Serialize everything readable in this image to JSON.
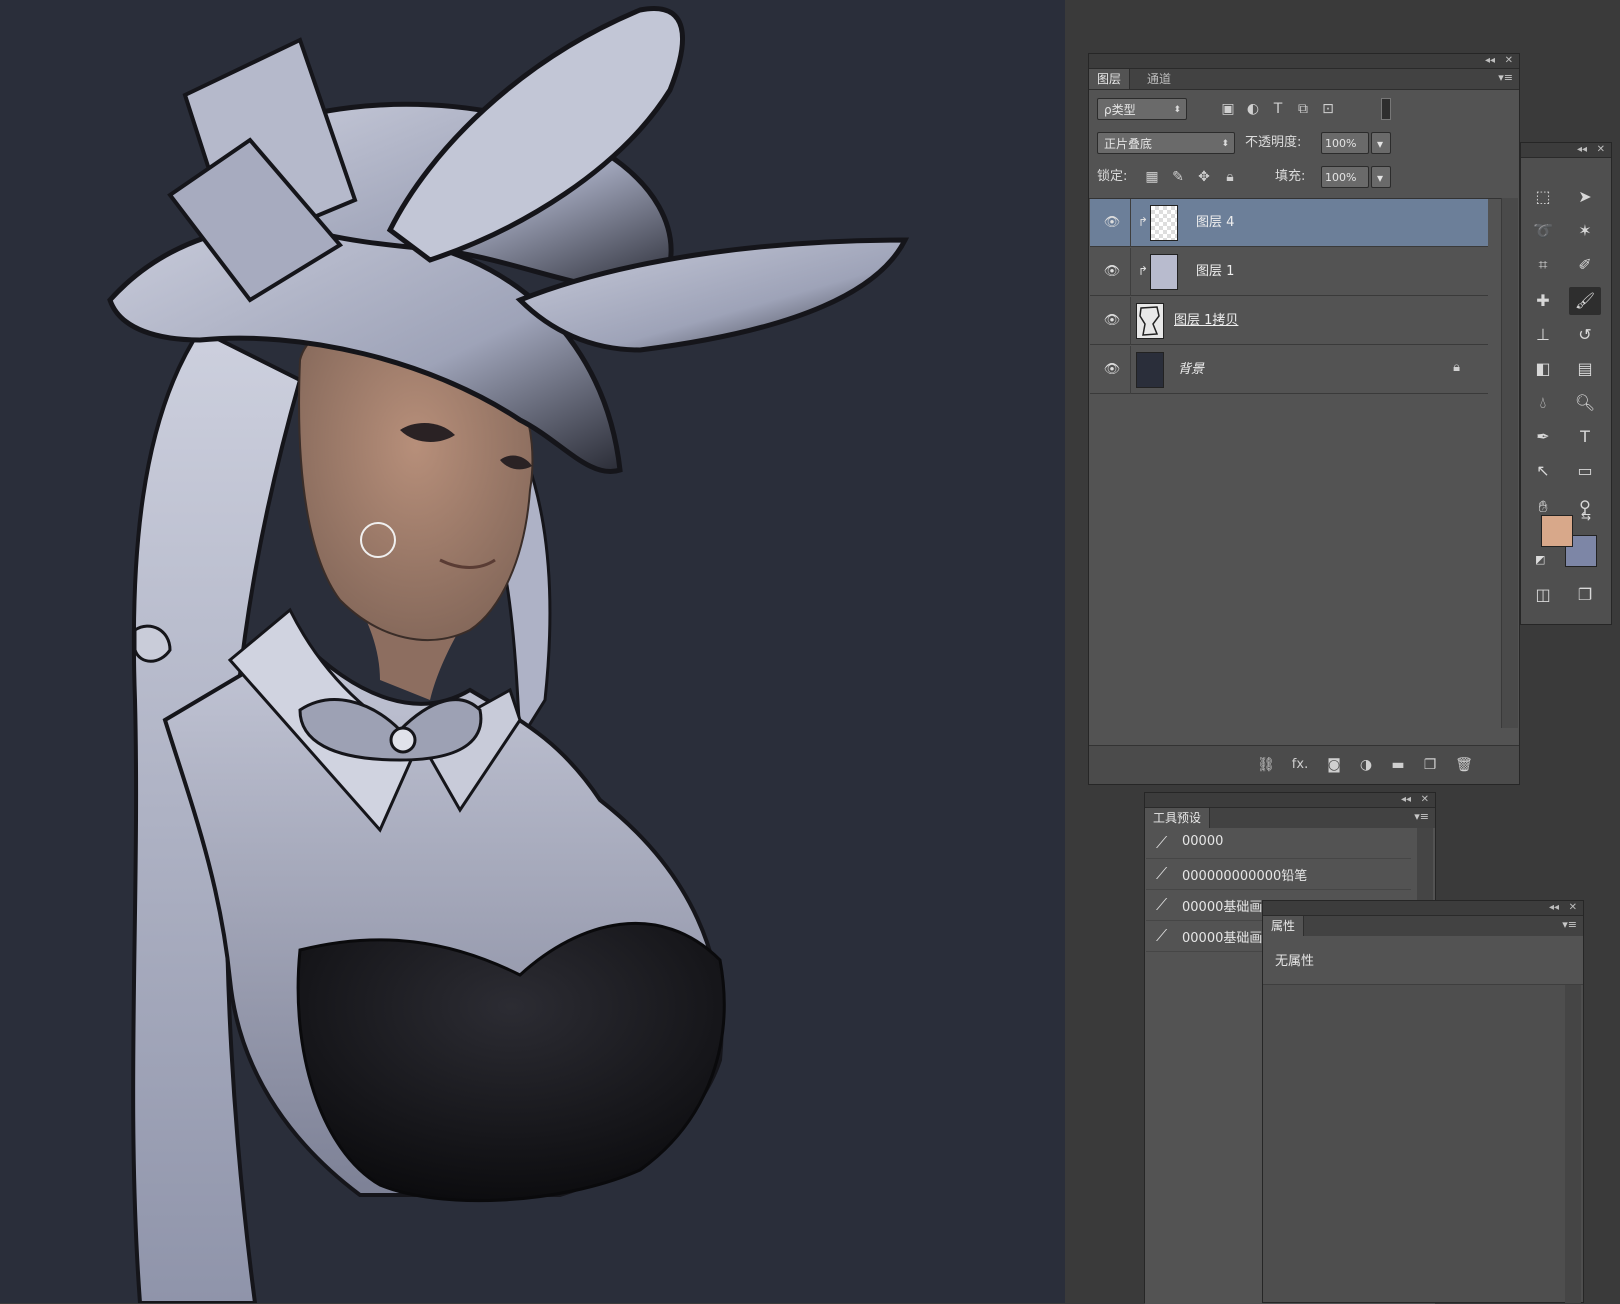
{
  "canvas": {
    "description_colors": {
      "background": "#2a2e3a",
      "skin": "#a57f6c",
      "hat": "#b6bacc",
      "dress": "#141416"
    }
  },
  "layers_panel": {
    "tabs": [
      {
        "label": "图层"
      },
      {
        "label": "通道"
      }
    ],
    "filter_kind": "ρ类型",
    "blend_mode": "正片叠底",
    "opacity_label": "不透明度:",
    "opacity_value": "100%",
    "lock_label": "锁定:",
    "fill_label": "填充:",
    "fill_value": "100%",
    "layers": [
      {
        "name": "图层 4",
        "selected": true,
        "clipped": true,
        "visible": true
      },
      {
        "name": "图层 1",
        "selected": false,
        "clipped": true,
        "visible": true
      },
      {
        "name": "图层 1拷贝",
        "selected": false,
        "clipped": false,
        "visible": true
      },
      {
        "name": "背景",
        "selected": false,
        "clipped": false,
        "visible": true,
        "locked": true
      }
    ],
    "footer_icons": [
      "link-icon",
      "fx-icon",
      "mask-icon",
      "adjustment-icon",
      "group-folder-icon",
      "new-layer-icon",
      "trash-icon"
    ],
    "fx_label": "fx."
  },
  "tool_presets_panel": {
    "tab": "工具预设",
    "presets": [
      "00000",
      "000000000000铅笔",
      "00000基础画",
      "00000基础画"
    ]
  },
  "properties_panel": {
    "tab": "属性",
    "empty_text": "无属性"
  },
  "toolbox": {
    "foreground_color": "#d8a88a",
    "background_color": "#7d86a6"
  },
  "panel_controls": {
    "collapse": "◂◂",
    "close": "✕",
    "menu": "▾≡"
  }
}
